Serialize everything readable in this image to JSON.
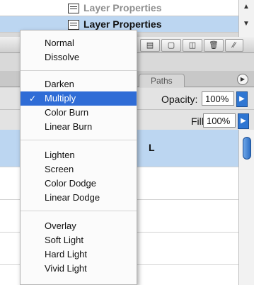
{
  "layers_top": {
    "rows": [
      {
        "label": "Layer Properties"
      },
      {
        "label": "Layer Properties"
      }
    ]
  },
  "tabs": [
    {
      "label": "Paths"
    }
  ],
  "opacity": {
    "label": "Opacity:",
    "value": "100%"
  },
  "fill": {
    "label": "Fill:",
    "value": "100%"
  },
  "layer_name_fragment": "L",
  "blend_menu": {
    "selected": "Multiply",
    "groups": [
      [
        "Normal",
        "Dissolve"
      ],
      [
        "Darken",
        "Multiply",
        "Color Burn",
        "Linear Burn"
      ],
      [
        "Lighten",
        "Screen",
        "Color Dodge",
        "Linear Dodge"
      ],
      [
        "Overlay",
        "Soft Light",
        "Hard Light",
        "Vivid Light"
      ]
    ],
    "items": {
      "normal": "Normal",
      "dissolve": "Dissolve",
      "darken": "Darken",
      "multiply": "Multiply",
      "color_burn": "Color Burn",
      "linear_burn": "Linear Burn",
      "lighten": "Lighten",
      "screen": "Screen",
      "color_dodge": "Color Dodge",
      "linear_dodge": "Linear Dodge",
      "overlay": "Overlay",
      "soft_light": "Soft Light",
      "hard_light": "Hard Light",
      "vivid_light": "Vivid Light"
    }
  },
  "colors": {
    "selection_blue": "#2f6cd6",
    "active_row": "#bcd6f1"
  }
}
